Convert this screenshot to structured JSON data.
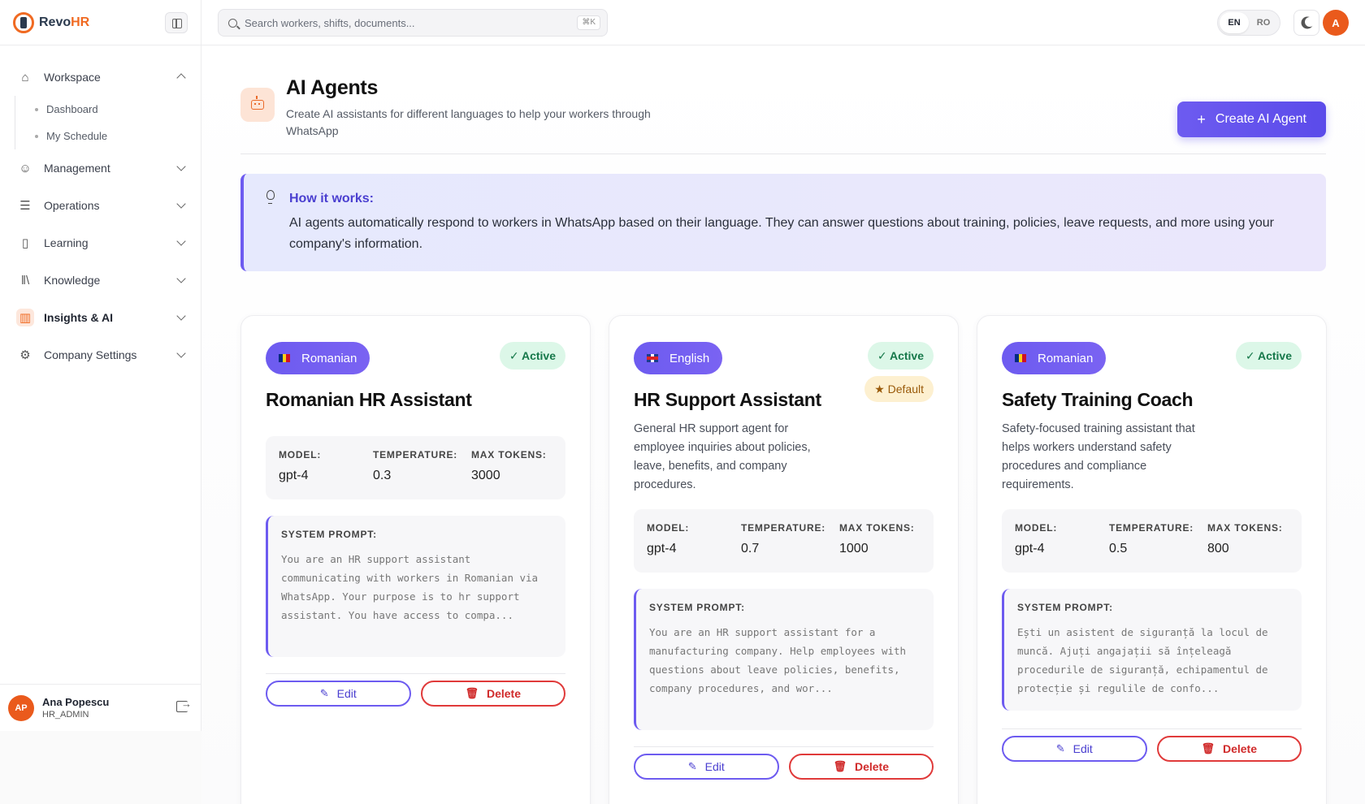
{
  "brand": {
    "name_part1": "Revo",
    "name_part2": "HR"
  },
  "search": {
    "placeholder": "Search workers, shifts, documents...",
    "shortcut": "⌘K"
  },
  "lang_switch": {
    "en": "EN",
    "ro": "RO"
  },
  "user_top": {
    "initial": "A"
  },
  "sidebar": {
    "workspace": "Workspace",
    "dashboard": "Dashboard",
    "schedule": "My Schedule",
    "management": "Management",
    "operations": "Operations",
    "learning": "Learning",
    "knowledge": "Knowledge",
    "insights": "Insights & AI",
    "settings": "Company Settings"
  },
  "user": {
    "initials": "AP",
    "name": "Ana Popescu",
    "role": "HR_ADMIN"
  },
  "header": {
    "title": "AI Agents",
    "subtitle": "Create AI assistants for different languages to help your workers through WhatsApp",
    "create_label": "Create AI Agent"
  },
  "info": {
    "title": "How it works:",
    "text": "AI agents automatically respond to workers in WhatsApp based on their language. They can answer questions about training, policies, leave requests, and more using your company's information."
  },
  "labels": {
    "model": "MODEL:",
    "temperature": "TEMPERATURE:",
    "max_tokens": "MAX TOKENS:",
    "system_prompt": "SYSTEM PROMPT:",
    "edit": "Edit",
    "delete": "Delete",
    "active": "✓ Active",
    "default": "★ Default"
  },
  "agents": [
    {
      "language": "Romanian",
      "name": "Romanian HR Assistant",
      "description": "",
      "model": "gpt-4",
      "temperature": "0.3",
      "max_tokens": "3000",
      "prompt": "You are an HR support assistant communicating with workers in Romanian via WhatsApp. Your purpose is to hr support assistant. You have access to compa..."
    },
    {
      "language": "English",
      "name": "HR Support Assistant",
      "description": "General HR support agent for employee inquiries about policies, leave, benefits, and company procedures.",
      "model": "gpt-4",
      "temperature": "0.7",
      "max_tokens": "1000",
      "prompt": "You are an HR support assistant for a manufacturing company. Help employees with questions about leave policies, benefits, company procedures, and wor..."
    },
    {
      "language": "Romanian",
      "name": "Safety Training Coach",
      "description": "Safety-focused training assistant that helps workers understand safety procedures and compliance requirements.",
      "model": "gpt-4",
      "temperature": "0.5",
      "max_tokens": "800",
      "prompt": "Ești un asistent de siguranță la locul de muncă. Ajuți angajații să înțeleagă procedurile de siguranță, echipamentul de protecție și regulile de confo..."
    }
  ],
  "colors": {
    "accent": "#6d5bf0",
    "brand": "#f06a22",
    "success": "#16784a",
    "danger": "#e03a3a"
  }
}
